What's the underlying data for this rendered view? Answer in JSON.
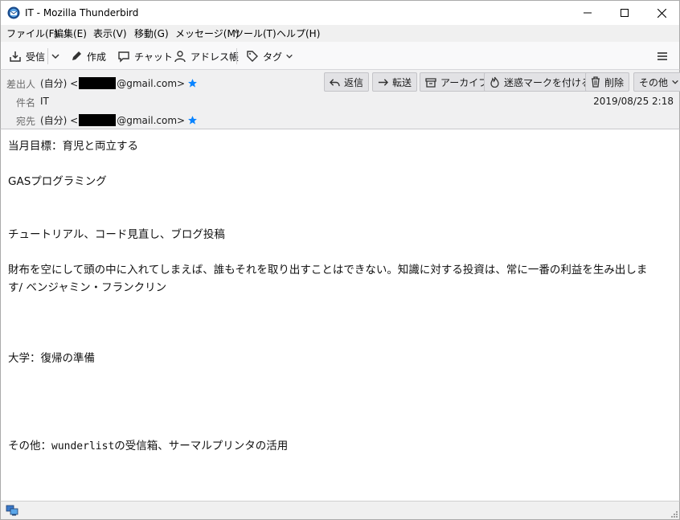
{
  "window": {
    "title": "IT - Mozilla Thunderbird",
    "minimize_icon": "minimize-icon",
    "maximize_icon": "maximize-icon",
    "close_icon": "close-icon"
  },
  "menu": [
    "ファイル(F)",
    "編集(E)",
    "表示(V)",
    "移動(G)",
    "メッセージ(M)",
    "ツール(T)",
    "ヘルプ(H)"
  ],
  "toolbar": {
    "get_mail": "受信",
    "write": "作成",
    "chat": "チャット",
    "address_book": "アドレス帳",
    "tag": "タグ"
  },
  "header": {
    "from_label": "差出人",
    "from_prefix": "(自分) <",
    "from_suffix": "@gmail.com>",
    "subject_label": "件名",
    "subject": "IT",
    "to_label": "宛先",
    "to_prefix": "(自分) <",
    "to_suffix": "@gmail.com>",
    "date": "2019/08/25 2:18",
    "buttons": {
      "reply": "返信",
      "forward": "転送",
      "archive": "アーカイブ",
      "junk": "迷惑マークを付ける",
      "delete": "削除",
      "other": "その他"
    }
  },
  "body": {
    "lines": [
      "当月目標：育児と両立する",
      "GASプログラミング",
      "チュートリアル、コード見直し、ブログ投稿",
      "財布を空にして頭の中に入れてしまえば、誰もそれを取り出すことはできない。知識に対する投資は、常に一番の利益を生み出しま",
      "す/ ベンジャミン・フランクリン",
      "大学：復帰の準備",
      "その他：",
      "wunderlist",
      "の受信箱、サーマルプリンタの活用"
    ]
  },
  "colors": {
    "star": "#0a84ff",
    "toolbar_bg": "#f9f9fa",
    "header_bg": "#f0f0f1",
    "button_bg": "#e2e2e5"
  }
}
